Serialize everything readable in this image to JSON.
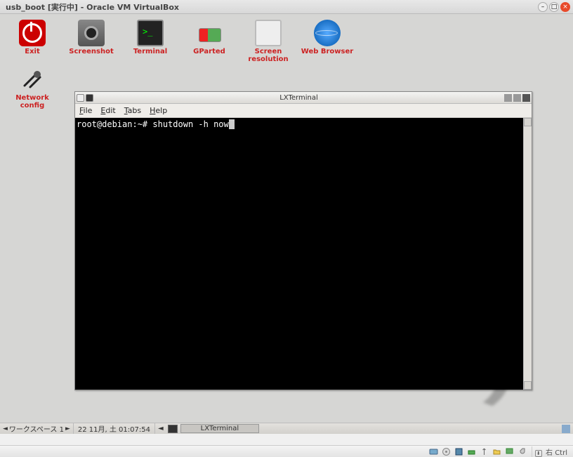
{
  "vbox": {
    "title": "usb_boot [実行中] - Oracle VM VirtualBox",
    "host_key": "右 Ctrl"
  },
  "desktop": {
    "icons": [
      {
        "label": "Exit",
        "icon": "exit-icon"
      },
      {
        "label": "Screenshot",
        "icon": "screenshot-icon"
      },
      {
        "label": "Terminal",
        "icon": "terminal-icon"
      },
      {
        "label": "GParted",
        "icon": "gparted-icon"
      },
      {
        "label": "Screen resolution",
        "icon": "screen-icon"
      },
      {
        "label": "Web Browser",
        "icon": "browser-icon"
      },
      {
        "label": "Network config",
        "icon": "network-icon"
      }
    ]
  },
  "lxterm": {
    "title": "LXTerminal",
    "menu": {
      "file": "File",
      "edit": "Edit",
      "tabs": "Tabs",
      "help": "Help"
    },
    "prompt": "root@debian:~# ",
    "command": "shutdown -h now"
  },
  "taskbar": {
    "workspace": "ワークスペース 1",
    "datetime": "22 11月, 土  01:07:54",
    "task_label": "LXTerminal"
  }
}
